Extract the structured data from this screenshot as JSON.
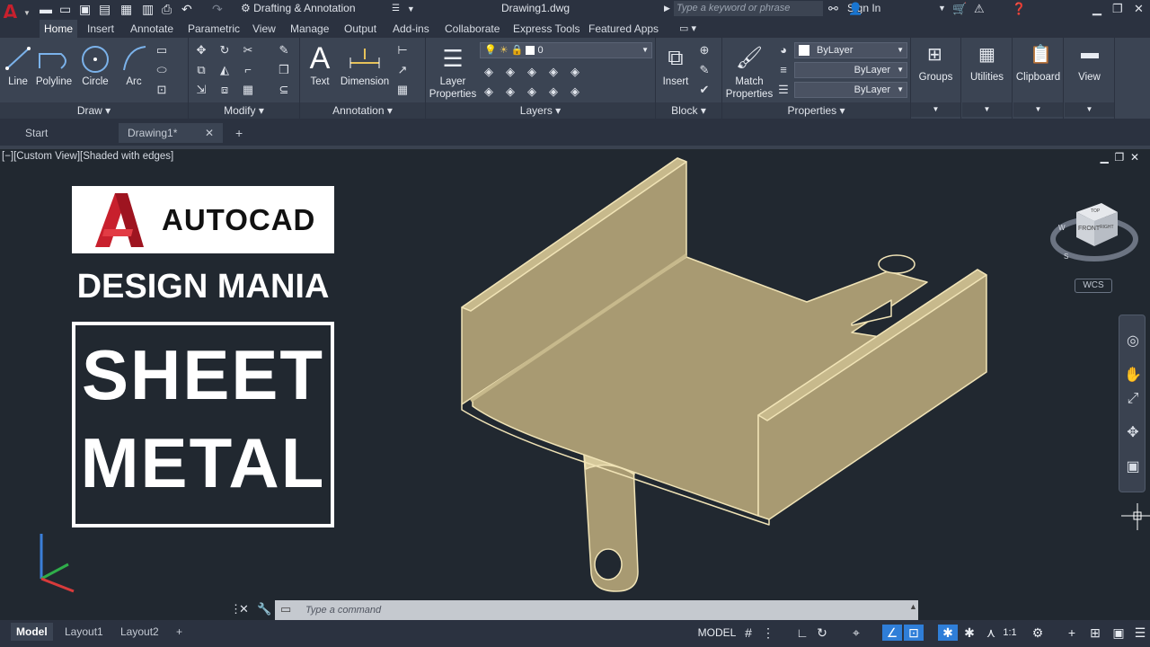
{
  "titlebar": {
    "app_logo": "A",
    "workspace": "Drafting & Annotation",
    "document": "Drawing1.dwg",
    "search_placeholder": "Type a keyword or phrase",
    "signin": "Sign In"
  },
  "tabs": [
    "Home",
    "Insert",
    "Annotate",
    "Parametric",
    "View",
    "Manage",
    "Output",
    "Add-ins",
    "Collaborate",
    "Express Tools",
    "Featured Apps"
  ],
  "ribbon": {
    "draw": {
      "title": "Draw",
      "line": "Line",
      "polyline": "Polyline",
      "circle": "Circle",
      "arc": "Arc"
    },
    "modify": {
      "title": "Modify"
    },
    "annotation": {
      "title": "Annotation",
      "text": "Text",
      "dimension": "Dimension"
    },
    "layers": {
      "title": "Layers",
      "layer_properties_1": "Layer",
      "layer_properties_2": "Properties",
      "current_layer": "0"
    },
    "block": {
      "title": "Block",
      "insert": "Insert"
    },
    "properties": {
      "title": "Properties",
      "match_1": "Match",
      "match_2": "Properties",
      "color": "ByLayer",
      "linetype": "ByLayer",
      "lineweight": "ByLayer"
    },
    "groups": "Groups",
    "utilities": "Utilities",
    "clipboard": "Clipboard",
    "view": "View"
  },
  "filetabs": {
    "start": "Start",
    "drawing": "Drawing1*"
  },
  "viewport": {
    "label": "[−][Custom View][Shaded with edges]",
    "logo_text": "AUTOCAD",
    "subtitle": "DESIGN MANIA",
    "title_line1": "SHEET",
    "title_line2": "METAL",
    "wcs": "WCS",
    "viewcube_top": "TOP",
    "viewcube_front": "FRONT",
    "viewcube_right": "RIGHT",
    "compass_w": "W",
    "compass_s": "S"
  },
  "command": {
    "placeholder": "Type a command"
  },
  "status": {
    "model_tab": "Model",
    "layout1": "Layout1",
    "layout2": "Layout2",
    "model_btn": "MODEL",
    "scale": "1:1"
  },
  "colors": {
    "accent": "#2f7ed8",
    "part_fill": "#a89a72",
    "part_edge": "#f0e3b6",
    "bg": "#212830"
  }
}
